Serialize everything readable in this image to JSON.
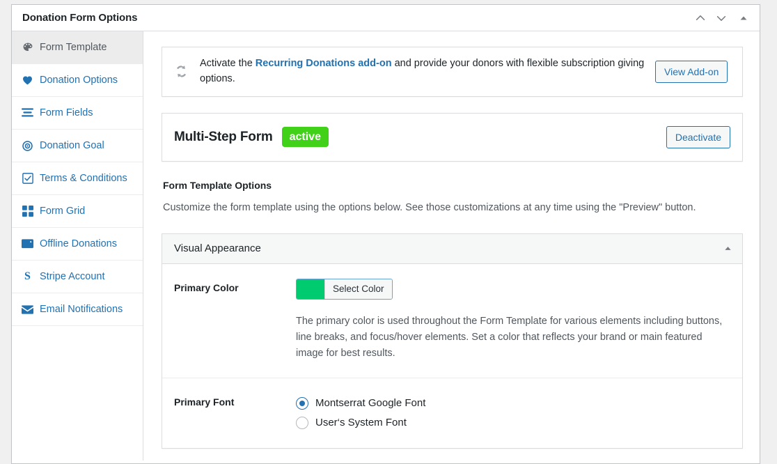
{
  "metabox": {
    "title": "Donation Form Options",
    "handles": {
      "move_up_icon": "chevron-up-icon",
      "move_down_icon": "chevron-down-icon",
      "toggle_icon": "triangle-up-icon"
    }
  },
  "sidebar": {
    "items": [
      {
        "label": "Form Template",
        "icon": "palette-icon",
        "active": true
      },
      {
        "label": "Donation Options",
        "icon": "heart-icon",
        "active": false
      },
      {
        "label": "Form Fields",
        "icon": "list-icon",
        "active": false
      },
      {
        "label": "Donation Goal",
        "icon": "target-icon",
        "active": false
      },
      {
        "label": "Terms & Conditions",
        "icon": "checkbox-icon",
        "active": false
      },
      {
        "label": "Form Grid",
        "icon": "grid-icon",
        "active": false
      },
      {
        "label": "Offline Donations",
        "icon": "wallet-icon",
        "active": false
      },
      {
        "label": "Stripe Account",
        "icon": "stripe-icon",
        "active": false
      },
      {
        "label": "Email Notifications",
        "icon": "envelope-icon",
        "active": false
      }
    ]
  },
  "notice": {
    "icon": "recurring-arrows-icon",
    "text_before": "Activate the ",
    "link_text": "Recurring Donations add-on",
    "text_after": " and provide your donors with flexible subscription giving options.",
    "button_label": "View Add-on"
  },
  "template_bar": {
    "name": "Multi-Step Form",
    "status_badge": "active",
    "badge_color": "#40d118",
    "button_label": "Deactivate"
  },
  "section": {
    "title": "Form Template Options",
    "description": "Customize the form template using the options below. See those customizations at any time using the \"Preview\" button."
  },
  "panel": {
    "title": "Visual Appearance",
    "toggle_icon": "triangle-up-icon",
    "fields": {
      "primary_color": {
        "label": "Primary Color",
        "swatch_color": "#00cb6e",
        "button_label": "Select Color",
        "help": "The primary color is used throughout the Form Template for various elements including buttons, line breaks, and focus/hover elements. Set a color that reflects your brand or main featured image for best results."
      },
      "primary_font": {
        "label": "Primary Font",
        "options": [
          {
            "label": "Montserrat Google Font",
            "checked": true
          },
          {
            "label": "User‘s System Font",
            "checked": false
          }
        ]
      }
    }
  },
  "colors": {
    "link": "#2271b1",
    "text": "#1d2327",
    "muted": "#50575e",
    "page_bg": "#f0f0f1"
  }
}
